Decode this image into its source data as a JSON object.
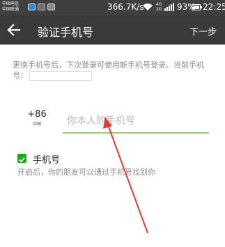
{
  "status_bar": {
    "carrier_line1": "中国电信",
    "carrier_line2": "中国联通",
    "notification_icons": [
      "app-notification-icon",
      "image-notification-icon",
      "gallery-notification-icon"
    ],
    "net_speed": "366.7K/s",
    "network_type": "4G 2G",
    "battery": "93%",
    "time": "22:25"
  },
  "title_bar": {
    "back_icon": "back-arrow-icon",
    "title": "验证手机号",
    "next_label": "下一步"
  },
  "content": {
    "hint_text": "更换手机号后，下次登录可使用新手机号登录。当前手机号：",
    "current_phone_value": "",
    "country_code": "+86",
    "country_name": "中国",
    "phone_placeholder": "你本人的手机号",
    "phone_value": "",
    "checkbox": {
      "checked": true,
      "label": "手机号",
      "description": "开启后，你的朋友可以通过手机号找到你"
    }
  },
  "colors": {
    "status_bar_bg": "#3f3f3f",
    "title_bar_bg": "#3a3a3a",
    "accent_green": "#1aad19",
    "input_underline": "#9ccc7a",
    "annotation_arrow": "#e53935"
  }
}
